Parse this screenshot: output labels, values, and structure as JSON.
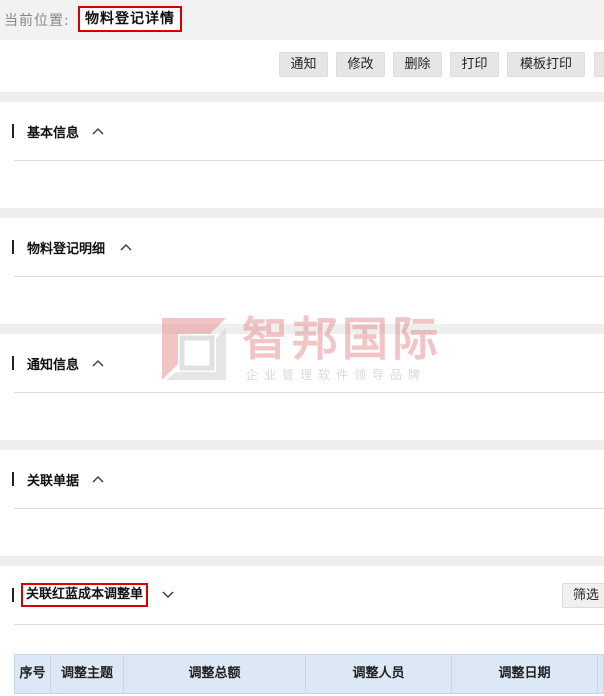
{
  "breadcrumb": {
    "prefix": "当前位置:",
    "current": "物料登记详情"
  },
  "toolbar": {
    "buttons": [
      "通知",
      "修改",
      "删除",
      "打印",
      "模板打印"
    ]
  },
  "sections": [
    {
      "title": "基本信息",
      "state": "expanded"
    },
    {
      "title": "物料登记明细",
      "state": "expanded"
    },
    {
      "title": "通知信息",
      "state": "expanded"
    },
    {
      "title": "关联单据",
      "state": "expanded"
    },
    {
      "title": "关联红蓝成本调整单",
      "state": "collapsed"
    }
  ],
  "filter_label": "筛选",
  "table": {
    "columns": [
      "序号",
      "调整主题",
      "调整总额",
      "调整人员",
      "调整日期"
    ]
  },
  "watermark": {
    "name": "智邦国际",
    "slogan": "企业管理软件领导品牌"
  },
  "colors": {
    "highlight_border": "#d40000",
    "table_header_bg": "#dde8f6",
    "watermark_red": "#e69696"
  }
}
